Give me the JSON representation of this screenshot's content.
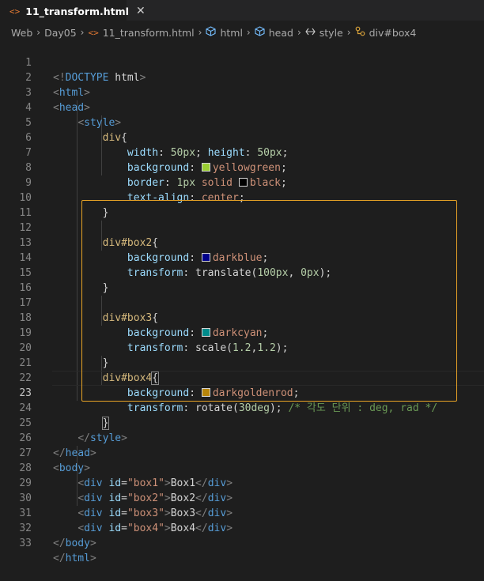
{
  "tab": {
    "icon": "<>",
    "title": "11_transform.html",
    "close": "✕"
  },
  "breadcrumb": {
    "items": [
      "Web",
      "Day05",
      "11_transform.html",
      "html",
      "head",
      "style",
      "div#box4"
    ]
  },
  "colors": {
    "yellowgreen": "#9acd32",
    "black": "#000000",
    "darkblue": "#00008b",
    "darkcyan": "#008b8b",
    "darkgoldenrod": "#b8860b",
    "selection_border": "#e8a326"
  },
  "code": {
    "line_numbers": [
      "1",
      "2",
      "3",
      "4",
      "5",
      "6",
      "7",
      "8",
      "9",
      "10",
      "11",
      "12",
      "13",
      "14",
      "15",
      "16",
      "17",
      "18",
      "19",
      "20",
      "21",
      "22",
      "23",
      "24",
      "25",
      "26",
      "27",
      "28",
      "29",
      "30",
      "31",
      "32",
      "33"
    ],
    "l1_open": "<!",
    "l1_doctype": "DOCTYPE",
    "l1_html": "html",
    "l1_close": ">",
    "l2": "html",
    "l3": "head",
    "l4": "style",
    "l5_sel": "div",
    "l5_brace": "{",
    "l6_p1": "width",
    "l6_v1": "50px",
    "l6_p2": "height",
    "l6_v2": "50px",
    "l7_prop": "background",
    "l7_val": "yellowgreen",
    "l8_prop": "border",
    "l8_num": "1px",
    "l8_solid": "solid",
    "l8_val": "black",
    "l9_prop": "text-align",
    "l9_val": "center",
    "close_brace": "}",
    "l12_sel": "div#box2",
    "l12_brace": "{",
    "l13_prop": "background",
    "l13_val": "darkblue",
    "l14_prop": "transform",
    "l14_fn": "translate",
    "l14_a1": "100px",
    "l14_a2": "0px",
    "l17_sel": "div#box3",
    "l17_brace": "{",
    "l18_prop": "background",
    "l18_val": "darkcyan",
    "l19_prop": "transform",
    "l19_fn": "scale",
    "l19_a1": "1.2",
    "l19_a2": "1.2",
    "l21_sel": "div#box4",
    "l21_brace": "{",
    "l22_prop": "background",
    "l22_val": "darkgoldenrod",
    "l23_prop": "transform",
    "l23_fn": "rotate",
    "l23_a1": "30deg",
    "l23_comment": "/* 각도 단위 : deg, rad */",
    "l25": "style",
    "l26": "head",
    "l27": "body",
    "div_tag": "div",
    "id_attr": "id",
    "box1_id": "\"box1\"",
    "box1_txt": "Box1",
    "box2_id": "\"box2\"",
    "box2_txt": "Box2",
    "box3_id": "\"box3\"",
    "box3_txt": "Box3",
    "box4_id": "\"box4\"",
    "box4_txt": "Box4",
    "l32": "body",
    "l33": "html"
  }
}
